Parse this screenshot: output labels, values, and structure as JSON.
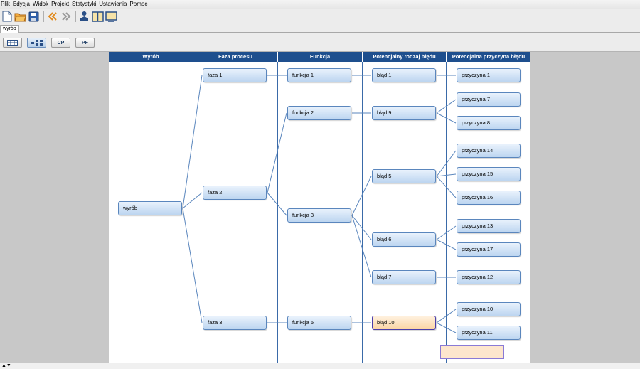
{
  "menu": [
    "Plik",
    "Edycja",
    "Widok",
    "Projekt",
    "Statystyki",
    "Ustawienia",
    "Pomoc"
  ],
  "toolbar": {
    "icons": [
      "new-document-icon",
      "open-folder-icon",
      "save-icon",
      "back-icon",
      "forward-icon",
      "structure-icon",
      "book-icon",
      "monitor-icon"
    ]
  },
  "tabs": [
    {
      "label": "wyrób"
    }
  ],
  "view_buttons": [
    {
      "icon": "table-view-icon",
      "label": ""
    },
    {
      "icon": "tree-view-icon",
      "label": ""
    },
    {
      "icon": "cp-view-icon",
      "label": "CP"
    },
    {
      "icon": "pf-view-icon",
      "label": "PF"
    }
  ],
  "columns": [
    "Wyrób",
    "Faza procesu",
    "Funkcja",
    "Potencjalny rodzaj błędu",
    "Potencjalna przyczyna błędu"
  ],
  "colors": {
    "header": "#1e4f8e",
    "node": "#bcd5f0",
    "selected": "#fbd5a4"
  },
  "nodes": {
    "product": "wyrób",
    "phase_1": "faza 1",
    "phase_2": "faza 2",
    "phase_3": "faza 3",
    "function_1": "funkcja 1",
    "function_2": "funkcja 2",
    "function_3": "funkcja 3",
    "function_5": "funkcja 5",
    "error_1": "błąd 1",
    "error_9": "błąd 9",
    "error_5": "błąd 5",
    "error_6": "błąd 6",
    "error_7": "błąd 7",
    "error_10": "błąd 10",
    "cause_1": "przyczyna 1",
    "cause_7": "przyczyna 7",
    "cause_8": "przyczyna 8",
    "cause_14": "przyczyna 14",
    "cause_15": "przyczyna 15",
    "cause_16": "przyczyna 16",
    "cause_13": "przyczyna 13",
    "cause_17": "przyczyna 17",
    "cause_12": "przyczyna 12",
    "cause_10": "przyczyna 10",
    "cause_11": "przyczyna 11"
  },
  "selected_node": "błąd 10"
}
